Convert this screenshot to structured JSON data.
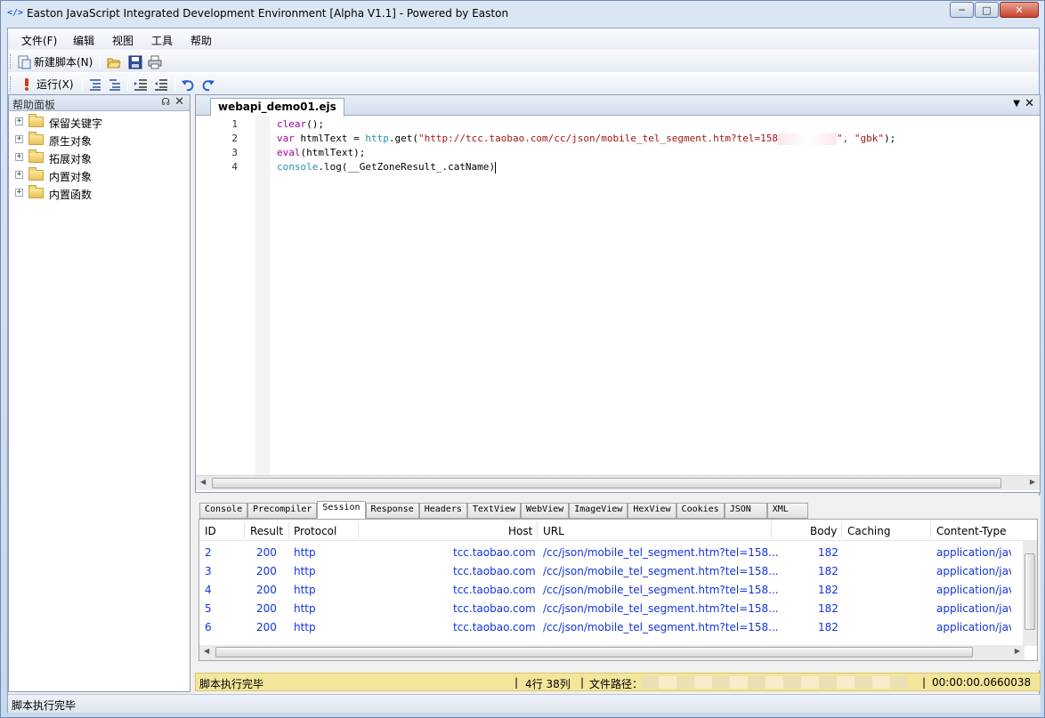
{
  "window": {
    "title": "Easton JavaScript Integrated Development Environment [Alpha V1.1] - Powered by Easton",
    "app_icon": "</>"
  },
  "menu": [
    "文件(F)",
    "编辑",
    "视图",
    "工具",
    "帮助"
  ],
  "toolbar": {
    "new_script_label": "新建脚本(N)",
    "run_label": "运行(X)"
  },
  "help_panel": {
    "title": "帮助面板",
    "items": [
      "保留关键字",
      "原生对象",
      "拓展对象",
      "内置对象",
      "内置函数"
    ]
  },
  "editor": {
    "tab_label": "webapi_demo01.ejs",
    "line_numbers": [
      "1",
      "2",
      "3",
      "4"
    ],
    "lines": {
      "l1_a": "clear",
      "l1_b": "();",
      "l2_a": "var",
      "l2_b": " htmlText = ",
      "l2_c": "http",
      "l2_d": ".get(",
      "l2_e": "\"http://tcc.taobao.com/cc/json/mobile_tel_segment.htm?tel=158",
      "l2_f": "\", \"gbk\"",
      "l2_g": ");",
      "l3_a": "eval",
      "l3_b": "(htmlText);",
      "l4_a": "console",
      "l4_b": ".log(",
      "l4_c": "__GetZoneResult_.catName",
      "l4_d": ")"
    }
  },
  "bottom_tabs": [
    "Console",
    "Precompiler",
    "Session",
    "Response",
    "Headers",
    "TextView",
    "WebView",
    "ImageView",
    "HexView",
    "Cookies",
    "JSON",
    "XML"
  ],
  "active_bottom_tab": "Session",
  "session": {
    "columns": [
      "ID",
      "Result",
      "Protocol",
      "Host",
      "URL",
      "Body",
      "Caching",
      "Content-Type"
    ],
    "rows": [
      {
        "id": "2",
        "result": "200",
        "protocol": "http",
        "host": "tcc.taobao.com",
        "url": "/cc/json/mobile_tel_segment.htm?tel=158...",
        "body": "182",
        "caching": "",
        "content_type": "application/jav"
      },
      {
        "id": "3",
        "result": "200",
        "protocol": "http",
        "host": "tcc.taobao.com",
        "url": "/cc/json/mobile_tel_segment.htm?tel=158...",
        "body": "182",
        "caching": "",
        "content_type": "application/jav"
      },
      {
        "id": "4",
        "result": "200",
        "protocol": "http",
        "host": "tcc.taobao.com",
        "url": "/cc/json/mobile_tel_segment.htm?tel=158...",
        "body": "182",
        "caching": "",
        "content_type": "application/jav"
      },
      {
        "id": "5",
        "result": "200",
        "protocol": "http",
        "host": "tcc.taobao.com",
        "url": "/cc/json/mobile_tel_segment.htm?tel=158...",
        "body": "182",
        "caching": "",
        "content_type": "application/jav"
      },
      {
        "id": "6",
        "result": "200",
        "protocol": "http",
        "host": "tcc.taobao.com",
        "url": "/cc/json/mobile_tel_segment.htm?tel=158...",
        "body": "182",
        "caching": "",
        "content_type": "application/jav"
      }
    ]
  },
  "exec_status": {
    "message": "脚本执行完毕",
    "position": "4行  38列",
    "path_label": "文件路径：",
    "elapsed": "00:00:00.0660038"
  },
  "statusbar": {
    "message": "脚本执行完毕"
  },
  "colors": {
    "keyword": "#a0009e",
    "string": "#a31515",
    "object": "#2b91af",
    "session_text": "#1133dd",
    "status_yellow": "#f3e59a"
  }
}
